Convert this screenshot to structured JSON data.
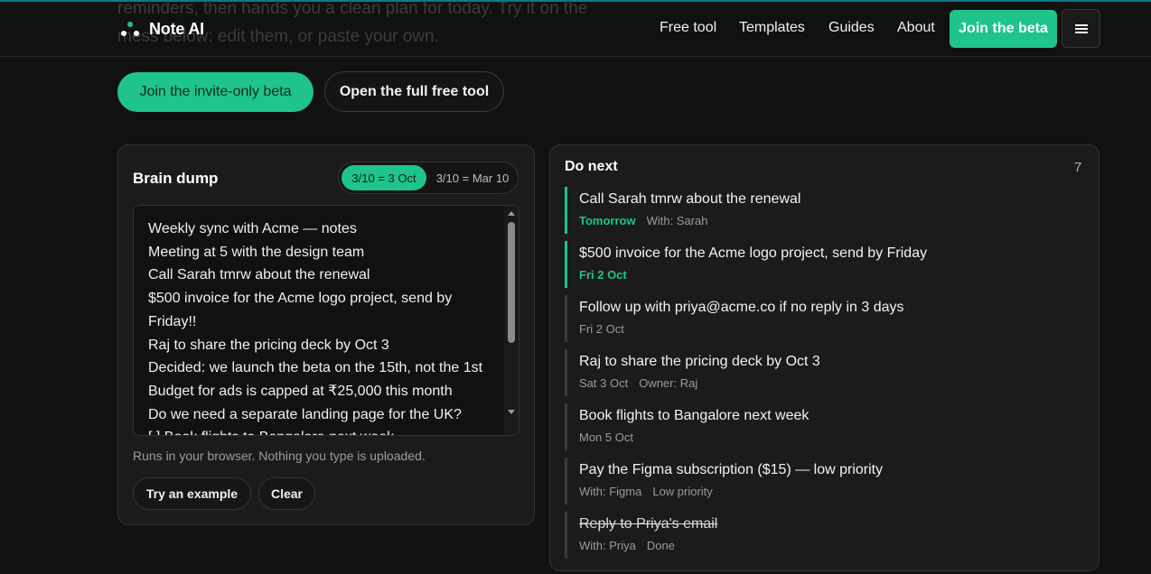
{
  "background_text": {
    "line1": "reminders, then hands you a clean plan for today. Try it on the",
    "line2": "mess below: edit them, or paste your own."
  },
  "header": {
    "brand": "Note AI",
    "nav": [
      "Free tool",
      "Templates",
      "Guides",
      "About"
    ],
    "cta": "Join the beta",
    "menu_icon": "hamburger-icon"
  },
  "hero_actions": {
    "primary": "Join the invite-only beta",
    "secondary": "Open the full free tool"
  },
  "brain_dump": {
    "title": "Brain dump",
    "date_format_options": [
      "3/10 = 3 Oct",
      "3/10 = Mar 10"
    ],
    "selected_format": "3/10 = 3 Oct",
    "lines": [
      "Weekly sync with Acme — notes",
      "Meeting at 5 with the design team",
      "Call Sarah tmrw about the renewal",
      "$500 invoice for the Acme logo project, send by",
      "Friday!!",
      "Raj to share the pricing deck by Oct 3",
      "Decided: we launch the beta on the 15th, not the 1st",
      "Budget for ads is capped at ₹25,000 this month",
      "Do we need a separate landing page for the UK?",
      "[ ] Book flights to Bangalore next week"
    ],
    "note": "Runs in your browser. Nothing you type is uploaded.",
    "buttons": {
      "example": "Try an example",
      "clear": "Clear"
    }
  },
  "do_next": {
    "title": "Do next",
    "count": "7",
    "tasks": [
      {
        "title": "Call Sarah tmrw about the renewal",
        "due": "Tomorrow",
        "extra": [
          "With: Sarah"
        ],
        "accent": true,
        "done": false
      },
      {
        "title": "$500 invoice for the Acme logo project, send by Friday",
        "due": "Fri 2 Oct",
        "extra": [],
        "accent": true,
        "done": false
      },
      {
        "title": "Follow up with priya@acme.co if no reply in 3 days",
        "due": "Fri 2 Oct",
        "extra": [],
        "accent": false,
        "done": false
      },
      {
        "title": "Raj to share the pricing deck by Oct 3",
        "due": "Sat 3 Oct",
        "extra": [
          "Owner: Raj"
        ],
        "accent": false,
        "done": false
      },
      {
        "title": "Book flights to Bangalore next week",
        "due": "Mon 5 Oct",
        "extra": [],
        "accent": false,
        "done": false
      },
      {
        "title": "Pay the Figma subscription ($15) — low priority",
        "due": "",
        "extra": [
          "With: Figma",
          "Low priority"
        ],
        "accent": false,
        "done": false
      },
      {
        "title": "Reply to Priya's email",
        "due": "",
        "extra": [
          "With: Priya",
          "Done"
        ],
        "accent": false,
        "done": true
      }
    ]
  },
  "colors": {
    "accent": "#1ec48c",
    "background": "#111111",
    "panel": "#1b1b1b"
  }
}
